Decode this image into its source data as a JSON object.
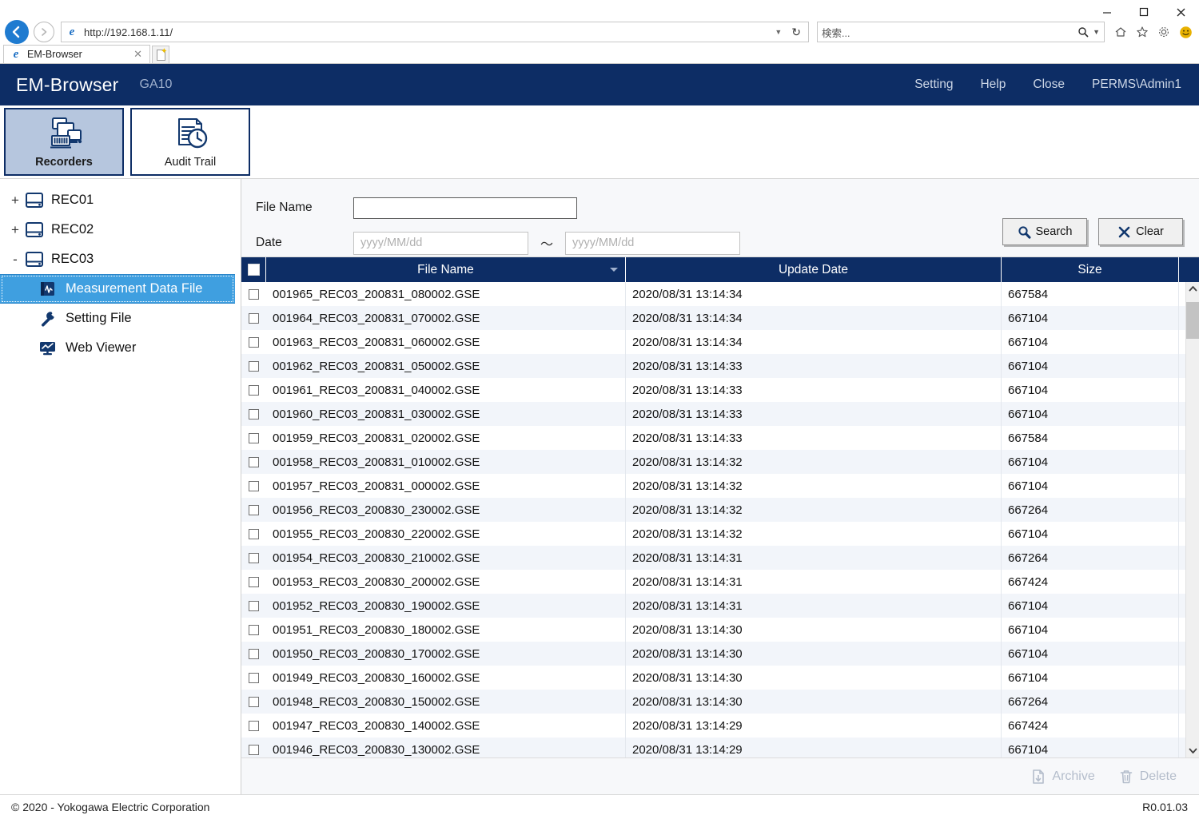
{
  "browser": {
    "url": "http://192.168.1.11/",
    "search_placeholder": "検索...",
    "tab_title": "EM-Browser",
    "tab_close": "✕",
    "minimize": "—",
    "maximize": "▢",
    "close": "✕",
    "refresh_icon": "↻",
    "url_dropdown_icon": "▾",
    "search_icon": "search-icon",
    "search_dropdown_icon": "▾",
    "home_icon": "⌂",
    "favorites_icon": "☆",
    "settings_icon": "⚙",
    "smiley_icon": "☺",
    "back_icon": "←",
    "forward_icon": "→"
  },
  "header": {
    "title": "EM-Browser",
    "subtitle": "GA10",
    "links": [
      "Setting",
      "Help",
      "Close"
    ],
    "user": "PERMS\\Admin1",
    "bg_color": "#0d2d65"
  },
  "ribbon": {
    "tabs": [
      {
        "label": "Recorders",
        "icon": "recorders-icon",
        "active": true
      },
      {
        "label": "Audit Trail",
        "icon": "audit-trail-icon",
        "active": false
      }
    ]
  },
  "sidebar": {
    "nodes": [
      {
        "label": "REC01",
        "toggle": "+",
        "icon": "recorder-device-icon"
      },
      {
        "label": "REC02",
        "toggle": "+",
        "icon": "recorder-device-icon"
      },
      {
        "label": "REC03",
        "toggle": "-",
        "icon": "recorder-device-icon"
      }
    ],
    "children": [
      {
        "label": "Measurement Data File",
        "icon": "measurement-data-icon",
        "selected": true
      },
      {
        "label": "Setting File",
        "icon": "wrench-icon",
        "selected": false
      },
      {
        "label": "Web Viewer",
        "icon": "monitor-chart-icon",
        "selected": false
      }
    ]
  },
  "search_panel": {
    "file_name_label": "File Name",
    "file_name_value": "",
    "file_name_placeholder": "",
    "date_label": "Date",
    "date_from_placeholder": "yyyy/MM/dd",
    "date_from_value": "",
    "date_to_placeholder": "yyyy/MM/dd",
    "date_to_value": "",
    "range_separator": "～",
    "search_button": "Search",
    "clear_button": "Clear"
  },
  "table": {
    "columns": [
      "File Name",
      "Update Date",
      "Size"
    ],
    "sort_column": "File Name",
    "sort_direction": "desc",
    "header_checkbox_checked": false,
    "rows": [
      {
        "name": "001965_REC03_200831_080002.GSE",
        "date": "2020/08/31 13:14:34",
        "size": "667584"
      },
      {
        "name": "001964_REC03_200831_070002.GSE",
        "date": "2020/08/31 13:14:34",
        "size": "667104"
      },
      {
        "name": "001963_REC03_200831_060002.GSE",
        "date": "2020/08/31 13:14:34",
        "size": "667104"
      },
      {
        "name": "001962_REC03_200831_050002.GSE",
        "date": "2020/08/31 13:14:33",
        "size": "667104"
      },
      {
        "name": "001961_REC03_200831_040002.GSE",
        "date": "2020/08/31 13:14:33",
        "size": "667104"
      },
      {
        "name": "001960_REC03_200831_030002.GSE",
        "date": "2020/08/31 13:14:33",
        "size": "667104"
      },
      {
        "name": "001959_REC03_200831_020002.GSE",
        "date": "2020/08/31 13:14:33",
        "size": "667584"
      },
      {
        "name": "001958_REC03_200831_010002.GSE",
        "date": "2020/08/31 13:14:32",
        "size": "667104"
      },
      {
        "name": "001957_REC03_200831_000002.GSE",
        "date": "2020/08/31 13:14:32",
        "size": "667104"
      },
      {
        "name": "001956_REC03_200830_230002.GSE",
        "date": "2020/08/31 13:14:32",
        "size": "667264"
      },
      {
        "name": "001955_REC03_200830_220002.GSE",
        "date": "2020/08/31 13:14:32",
        "size": "667104"
      },
      {
        "name": "001954_REC03_200830_210002.GSE",
        "date": "2020/08/31 13:14:31",
        "size": "667264"
      },
      {
        "name": "001953_REC03_200830_200002.GSE",
        "date": "2020/08/31 13:14:31",
        "size": "667424"
      },
      {
        "name": "001952_REC03_200830_190002.GSE",
        "date": "2020/08/31 13:14:31",
        "size": "667104"
      },
      {
        "name": "001951_REC03_200830_180002.GSE",
        "date": "2020/08/31 13:14:30",
        "size": "667104"
      },
      {
        "name": "001950_REC03_200830_170002.GSE",
        "date": "2020/08/31 13:14:30",
        "size": "667104"
      },
      {
        "name": "001949_REC03_200830_160002.GSE",
        "date": "2020/08/31 13:14:30",
        "size": "667104"
      },
      {
        "name": "001948_REC03_200830_150002.GSE",
        "date": "2020/08/31 13:14:30",
        "size": "667264"
      },
      {
        "name": "001947_REC03_200830_140002.GSE",
        "date": "2020/08/31 13:14:29",
        "size": "667424"
      },
      {
        "name": "001946_REC03_200830_130002.GSE",
        "date": "2020/08/31 13:14:29",
        "size": "667104"
      }
    ],
    "scroll_up_icon": "⌃",
    "scroll_down_icon": "⌄"
  },
  "bottom_bar": {
    "archive_label": "Archive",
    "delete_label": "Delete"
  },
  "footer": {
    "copyright": "© 2020 - Yokogawa Electric Corporation",
    "version": "R0.01.03"
  }
}
